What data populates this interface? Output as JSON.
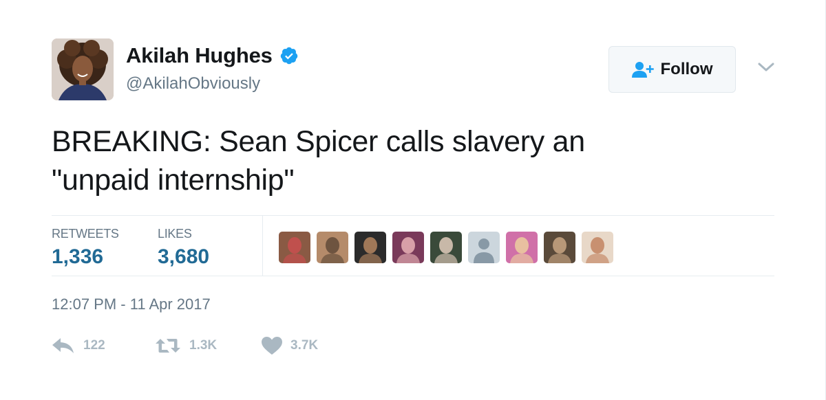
{
  "user": {
    "display_name": "Akilah Hughes",
    "handle": "@AkilahObviously",
    "verified": true
  },
  "follow_button": {
    "label": "Follow"
  },
  "tweet": {
    "text_line1": "BREAKING: Sean Spicer calls slavery an",
    "text_line2": "\"unpaid internship\""
  },
  "stats": {
    "retweets_label": "RETWEETS",
    "retweets_value": "1,336",
    "likes_label": "LIKES",
    "likes_value": "3,680"
  },
  "likers": [
    {
      "colors": [
        "#8a5a44",
        "#c0504d"
      ]
    },
    {
      "colors": [
        "#b58b6a",
        "#6e5440"
      ]
    },
    {
      "colors": [
        "#2b2b2b",
        "#a07858"
      ]
    },
    {
      "colors": [
        "#7a3a5a",
        "#d8a0a8"
      ]
    },
    {
      "colors": [
        "#3a4a3a",
        "#c8b8a8"
      ]
    },
    {
      "colors": [
        "#ccd6dd",
        "#8899a6"
      ],
      "default": true
    },
    {
      "colors": [
        "#d070a8",
        "#e8c0a0"
      ]
    },
    {
      "colors": [
        "#5a4a3a",
        "#b89878"
      ]
    },
    {
      "colors": [
        "#e8d8c8",
        "#c89070"
      ]
    }
  ],
  "timestamp": "12:07 PM - 11 Apr 2017",
  "actions": {
    "reply_count": "122",
    "retweet_count": "1.3K",
    "like_count": "3.7K"
  },
  "colors": {
    "verified_blue": "#1da1f2",
    "stat_value": "#216a95",
    "muted_icon": "#aab8c2",
    "secondary_text": "#657786"
  },
  "icons": {
    "verified": "verified-badge-icon",
    "follow": "add-user-icon",
    "caret": "chevron-down-icon",
    "reply": "reply-icon",
    "retweet": "retweet-icon",
    "like": "heart-icon"
  }
}
